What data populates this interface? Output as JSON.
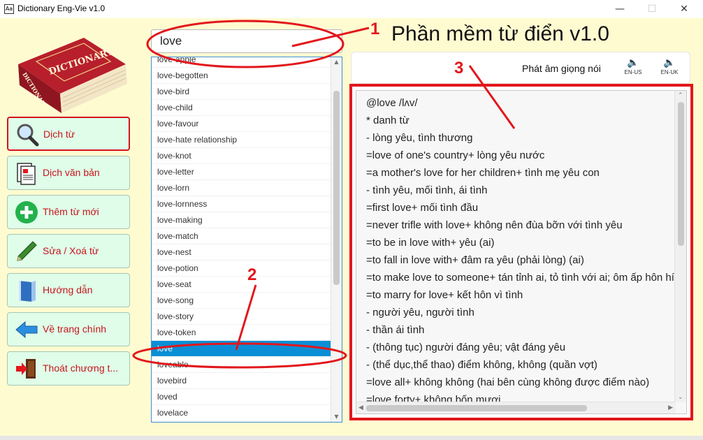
{
  "window": {
    "title": "Dictionary Eng-Vie v1.0",
    "app_icon_glyph": "Aa"
  },
  "logo": {
    "text_cover": "DICTIONARY",
    "text_spine": "DICTIONARY"
  },
  "nav": [
    {
      "label": "Dịch từ",
      "icon": "magnifier-icon"
    },
    {
      "label": "Dịch văn bản",
      "icon": "document-icon"
    },
    {
      "label": "Thêm từ mới",
      "icon": "plus-icon"
    },
    {
      "label": "Sửa / Xoá từ",
      "icon": "pen-icon"
    },
    {
      "label": "Hướng dẫn",
      "icon": "book-icon"
    },
    {
      "label": "Về trang chính",
      "icon": "arrow-left-icon"
    },
    {
      "label": "Thoát chương t...",
      "icon": "exit-door-icon"
    }
  ],
  "search": {
    "value": "love"
  },
  "wordlist": [
    "love-apple",
    "love-begotten",
    "love-bird",
    "love-child",
    "love-favour",
    "love-hate relationship",
    "love-knot",
    "love-letter",
    "love-lorn",
    "love-lornness",
    "love-making",
    "love-match",
    "love-nest",
    "love-potion",
    "love-seat",
    "love-song",
    "love-story",
    "love-token",
    "love",
    "loveable",
    "lovebird",
    "loved",
    "lovelace"
  ],
  "selected_word": "love",
  "heading": "Phần mềm từ điển v1.0",
  "pronounce": {
    "label": "Phát âm giọng nói",
    "us": "EN-US",
    "uk": "EN-UK"
  },
  "definition": [
    "@love /lʌv/",
    "*  danh từ",
    "- lòng yêu, tình thương",
    "=love of one's country+ lòng yêu nước",
    "=a mother's love for her children+ tình mẹ yêu con",
    "- tình yêu, mối tình, ái tình",
    "=first love+ mối tình đầu",
    "=never trifle with love+ không nên đùa bỡn với tình yêu",
    "=to be in love with+ yêu (ai)",
    "=to fall in love with+ đâm ra yêu (phải lòng) (ai)",
    "=to make love to someone+ tán tỉnh ai, tỏ tình với ai; ôm ấp hôn hít ai",
    "=to marry for love+ kết hôn vì tình",
    "- người yêu, người tình",
    "- thần ái tình",
    "- (thông tục) người đáng yêu; vật đáng yêu",
    "- (thể dục,thể thao) điểm không, không (quần vợt)",
    "=love all+ không không (hai bên cùng không được điểm nào)",
    "=love forty+ không bốn mươi"
  ],
  "annotations": [
    "1",
    "2",
    "3"
  ],
  "colors": {
    "accent_red": "#e2171c",
    "selection_blue": "#0a8fd6",
    "nav_bg": "#dffde9",
    "window_bg": "#fffbd1"
  }
}
